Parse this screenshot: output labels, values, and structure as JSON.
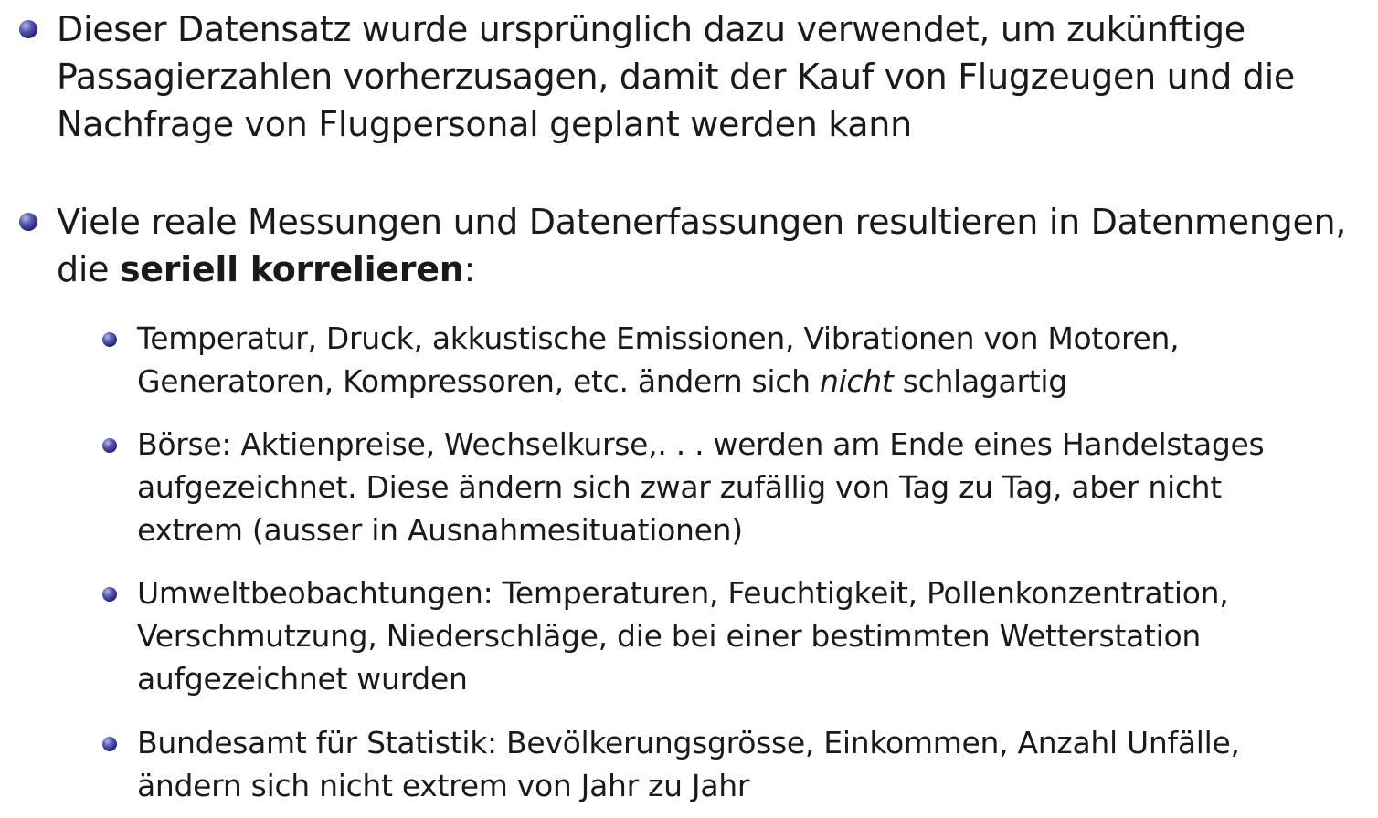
{
  "bullets": [
    {
      "text": "Dieser Datensatz wurde ursprünglich dazu verwendet, um zukünftige Passagierzahlen vorherzusagen, damit der Kauf von Flugzeugen und die Nachfrage von Flugpersonal geplant werden kann"
    },
    {
      "text_before": "Viele reale Messungen und Datenerfassungen resultieren in Datenmengen, die ",
      "bold": "seriell korrelieren",
      "text_after": ":",
      "subitems": [
        {
          "text_before": "Temperatur, Druck, akkustische Emissionen, Vibrationen von Motoren, Generatoren, Kompressoren, etc. ändern sich ",
          "italic": "nicht",
          "text_after": " schlagartig"
        },
        {
          "text": "Börse: Aktienpreise, Wechselkurse,. . . werden am Ende eines Handelstages aufgezeichnet. Diese ändern sich zwar zufällig von Tag zu Tag, aber nicht extrem (ausser in Ausnahmesituationen)"
        },
        {
          "text": "Umweltbeobachtungen: Temperaturen, Feuchtigkeit, Pollenkonzentration, Verschmutzung, Niederschläge, die bei einer bestimmten Wetterstation aufgezeichnet wurden"
        },
        {
          "text": "Bundesamt für Statistik: Bevölkerungsgrösse, Einkommen, Anzahl Unfälle, ändern sich nicht extrem von Jahr zu Jahr"
        }
      ]
    }
  ]
}
